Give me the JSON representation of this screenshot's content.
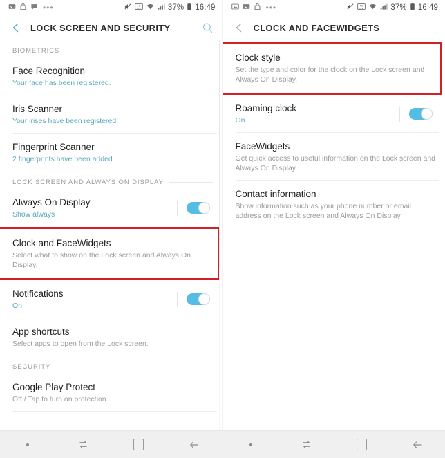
{
  "left_screen": {
    "status_bar": {
      "icons": [
        "gallery-icon",
        "bag-icon",
        "chat-icon"
      ],
      "overflow": "•••",
      "mute_icon": "mute-icon",
      "network_icon": "lte-icon",
      "wifi_icon": "wifi-icon",
      "signal_icon": "signal-icon",
      "battery_percent": "37%",
      "battery_icon": "battery-icon",
      "time": "16:49"
    },
    "app_bar": {
      "back_icon": "back-arrow-icon",
      "title": "LOCK SCREEN AND SECURITY",
      "search_icon": "search-icon"
    },
    "sections": [
      {
        "header": "BIOMETRICS",
        "rows": [
          {
            "title": "Face Recognition",
            "sub": "Your face has been registered.",
            "sub_style": "accent",
            "toggle": null,
            "highlighted": false
          },
          {
            "title": "Iris Scanner",
            "sub": "Your irises have been registered.",
            "sub_style": "accent",
            "toggle": null,
            "highlighted": false
          },
          {
            "title": "Fingerprint Scanner",
            "sub": "2 fingerprints have been added.",
            "sub_style": "accent",
            "toggle": null,
            "highlighted": false
          }
        ]
      },
      {
        "header": "LOCK SCREEN AND ALWAYS ON DISPLAY",
        "rows": [
          {
            "title": "Always On Display",
            "sub": "Show always",
            "sub_style": "accent",
            "toggle": "on",
            "highlighted": false
          },
          {
            "title": "Clock and FaceWidgets",
            "sub": "Select what to show on the Lock screen and Always On Display.",
            "sub_style": "muted",
            "toggle": null,
            "highlighted": true
          },
          {
            "title": "Notifications",
            "sub": "On",
            "sub_style": "accent",
            "toggle": "on",
            "highlighted": false
          },
          {
            "title": "App shortcuts",
            "sub": "Select apps to open from the Lock screen.",
            "sub_style": "muted",
            "toggle": null,
            "highlighted": false
          }
        ]
      },
      {
        "header": "SECURITY",
        "rows": [
          {
            "title": "Google Play Protect",
            "sub": "Off / Tap to turn on protection.",
            "sub_style": "muted",
            "toggle": null,
            "highlighted": false
          }
        ]
      }
    ],
    "nav_bar": {
      "dot": "dot-indicator-icon",
      "recents": "recents-icon",
      "home": "home-icon",
      "back": "back-icon"
    }
  },
  "right_screen": {
    "status_bar": {
      "icons": [
        "photo-icon",
        "gallery-icon",
        "bag-icon"
      ],
      "overflow": "•••",
      "mute_icon": "mute-icon",
      "network_icon": "lte-icon",
      "wifi_icon": "wifi-icon",
      "signal_icon": "signal-icon",
      "battery_percent": "37%",
      "battery_icon": "battery-icon",
      "time": "16:49"
    },
    "app_bar": {
      "back_icon": "back-arrow-icon",
      "title": "CLOCK AND FACEWIDGETS",
      "search_icon": null
    },
    "sections": [
      {
        "header": null,
        "rows": [
          {
            "title": "Clock style",
            "sub": "Set the type and color for the clock on the Lock screen and Always On Display.",
            "sub_style": "muted",
            "toggle": null,
            "highlighted": true
          },
          {
            "title": "Roaming clock",
            "sub": "On",
            "sub_style": "accent",
            "toggle": "on",
            "highlighted": false
          },
          {
            "title": "FaceWidgets",
            "sub": "Get quick access to useful information on the Lock screen and Always On Display.",
            "sub_style": "muted",
            "toggle": null,
            "highlighted": false
          },
          {
            "title": "Contact information",
            "sub": "Show information such as your phone number or email address on the Lock screen and Always On Display.",
            "sub_style": "muted",
            "toggle": null,
            "highlighted": false
          }
        ]
      }
    ],
    "nav_bar": {
      "dot": "dot-indicator-icon",
      "recents": "recents-icon",
      "home": "home-icon",
      "back": "back-icon"
    }
  },
  "theme": {
    "accent_blue": "#5ba9bb",
    "toggle_on": "#55bce5",
    "highlight_red": "#d32026",
    "title_color": "#1f1f1f",
    "muted_color": "#9d9d9d"
  }
}
